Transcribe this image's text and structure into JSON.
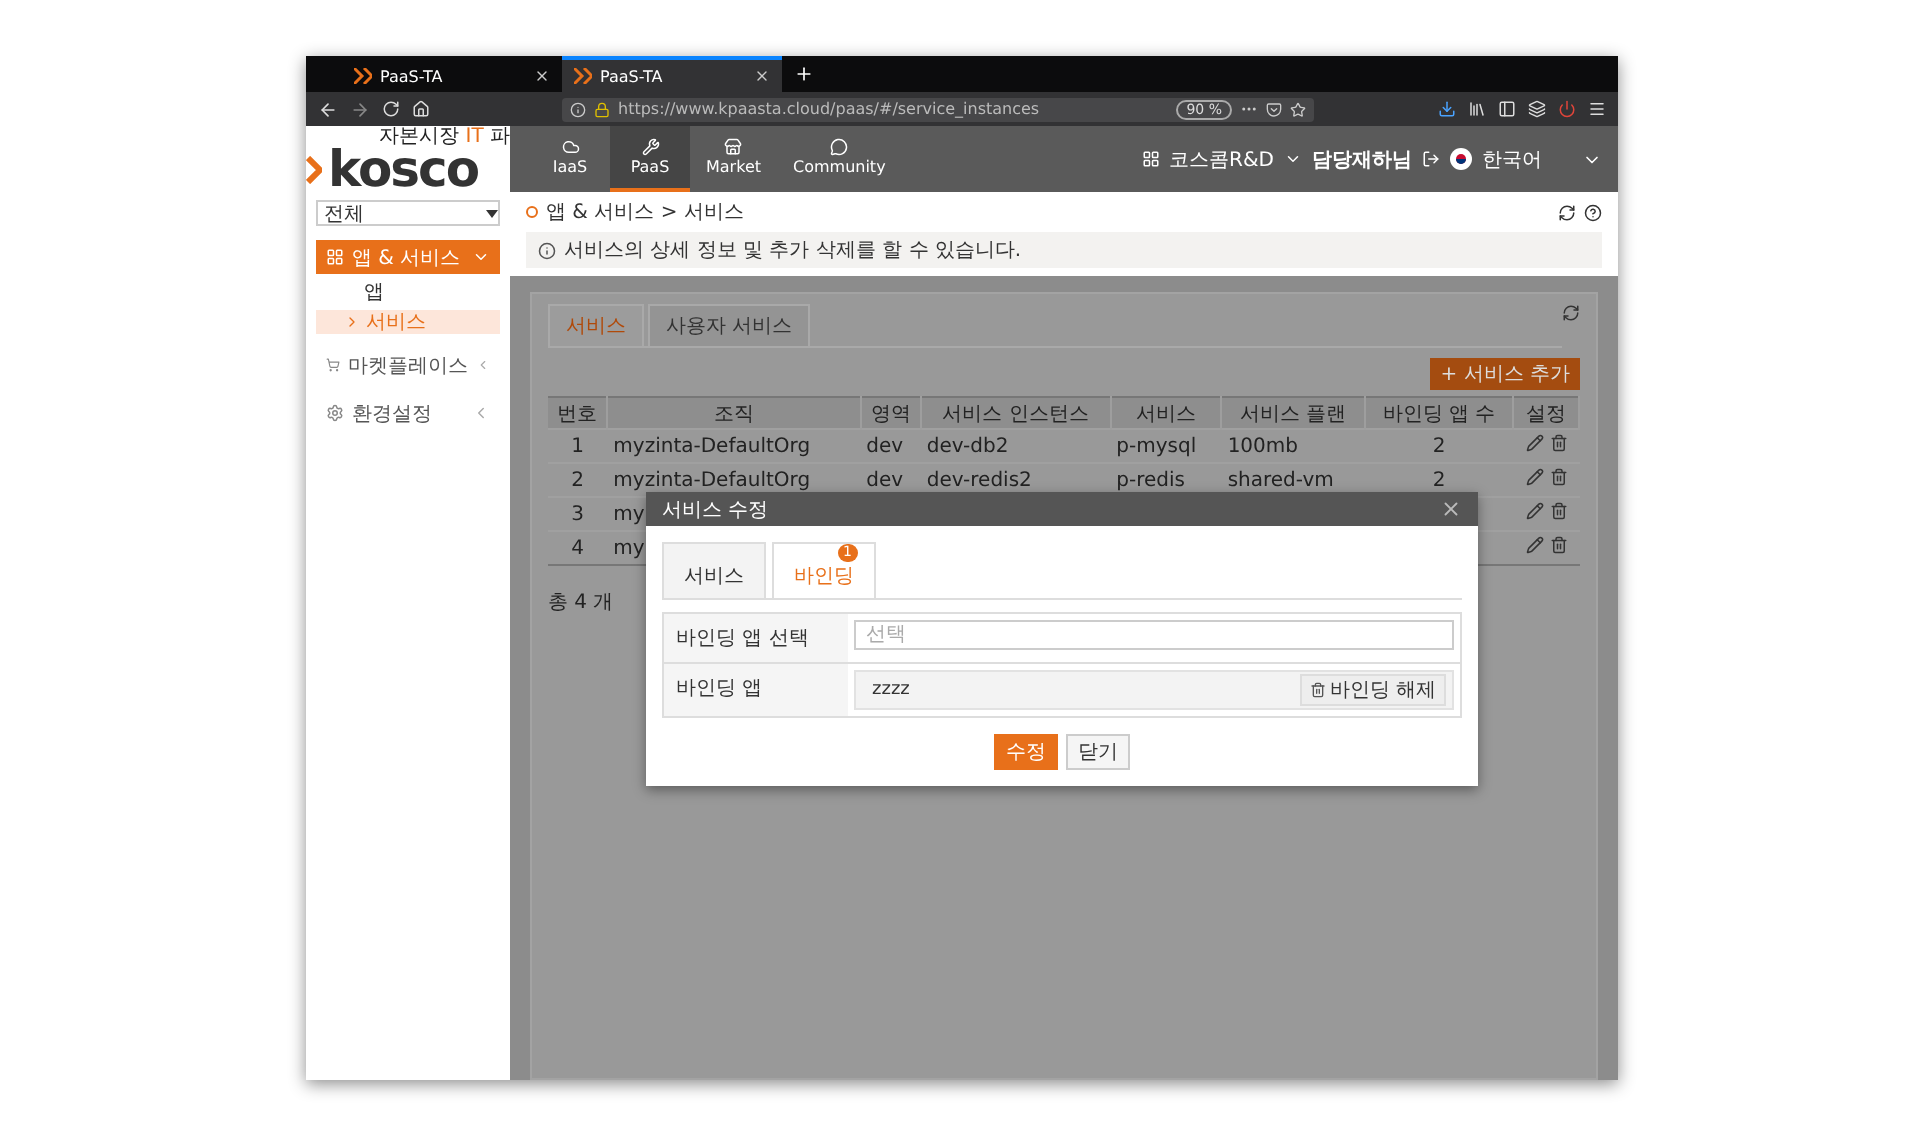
{
  "browser": {
    "tabs": [
      {
        "title": "PaaS-TA",
        "selected": false
      },
      {
        "title": "PaaS-TA",
        "selected": true
      }
    ],
    "url": "https://www.kpaasta.cloud/paas/#/service_instances",
    "zoom": "90 %"
  },
  "header": {
    "tagline_prefix": "자본시장",
    "tagline_highlight": "IT",
    "tagline_suffix": "파",
    "logo": "kosco",
    "nav": [
      {
        "label": "IaaS",
        "selected": false
      },
      {
        "label": "PaaS",
        "selected": true
      },
      {
        "label": "Market",
        "selected": false
      },
      {
        "label": "Community",
        "selected": false
      }
    ],
    "org": "코스콤R&D",
    "user": "담당재하님",
    "language": "한국어"
  },
  "sidebar": {
    "select": "전체",
    "items": [
      {
        "label": "앱 & 서비스",
        "expanded": true,
        "children": [
          {
            "label": "앱",
            "selected": false
          },
          {
            "label": "서비스",
            "selected": true
          }
        ]
      },
      {
        "label": "마켓플레이스",
        "expanded": false
      },
      {
        "label": "환경설정",
        "expanded": false
      }
    ]
  },
  "breadcrumb": "앱 & 서비스 > 서비스",
  "info": "서비스의 상세 정보 및 추가 삭제를 할 수 있습니다.",
  "tabs": [
    {
      "label": "서비스",
      "selected": true
    },
    {
      "label": "사용자 서비스",
      "selected": false
    }
  ],
  "add_button": "+ 서비스 추가",
  "table": {
    "columns": [
      "번호",
      "조직",
      "영역",
      "서비스 인스턴스",
      "서비스",
      "서비스 플랜",
      "바인딩 앱 수",
      "설정"
    ],
    "rows": [
      {
        "cells": [
          "1",
          "myzinta-DefaultOrg",
          "dev",
          "dev-db2",
          "p-mysql",
          "100mb",
          "2"
        ]
      },
      {
        "cells": [
          "2",
          "myzinta-DefaultOrg",
          "dev",
          "dev-redis2",
          "p-redis",
          "shared-vm",
          "2"
        ]
      },
      {
        "cells": [
          "3",
          "my",
          "",
          "",
          "",
          "",
          ""
        ]
      },
      {
        "cells": [
          "4",
          "my",
          "",
          "",
          "",
          "",
          ""
        ]
      }
    ]
  },
  "total": "총 4 개",
  "modal": {
    "title": "서비스 수정",
    "tabs": [
      {
        "label": "서비스",
        "selected": false
      },
      {
        "label": "바인딩",
        "selected": true,
        "badge": "1"
      }
    ],
    "fields": [
      {
        "label": "바인딩 앱 선택",
        "kind": "input",
        "placeholder": "선택"
      },
      {
        "label": "바인딩 앱",
        "kind": "app",
        "value": "zzzz",
        "action": "바인딩 해제"
      }
    ],
    "buttons": [
      {
        "label": "수정",
        "primary": true
      },
      {
        "label": "닫기",
        "primary": false
      }
    ]
  }
}
